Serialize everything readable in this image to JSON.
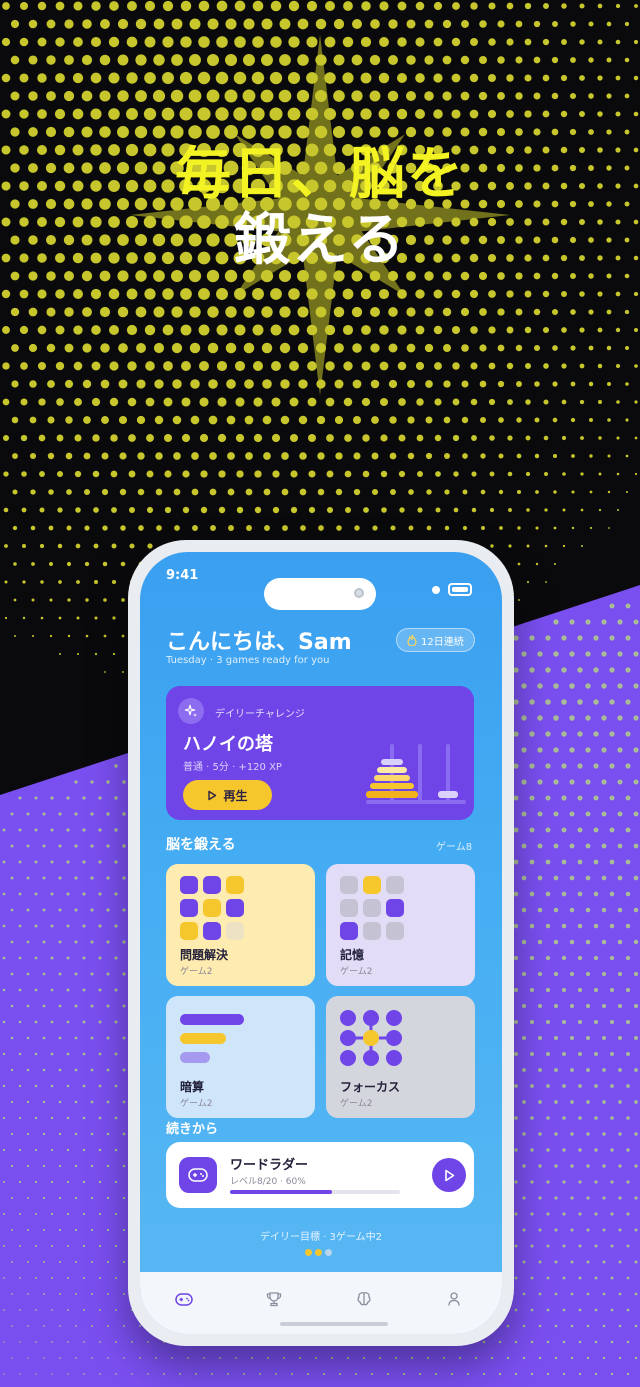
{
  "headline": {
    "line1": "毎日、脳を",
    "line2": "鍛える"
  },
  "colors": {
    "accent_yellow": "#f3f323",
    "purple": "#6f45e8",
    "sky_blue": "#46aef3",
    "gold": "#f6c62d"
  },
  "status_bar": {
    "time": "9:41"
  },
  "header": {
    "greeting": "こんにちは、Sam",
    "subtitle": "Tuesday · 3 games ready for you",
    "streak": "12日連続",
    "streak_icon": "flame-icon"
  },
  "daily_challenge": {
    "tag": "デイリーチャレンジ",
    "title": "ハノイの塔",
    "meta": "普通 · 5分 · +120 XP",
    "play_label": "再生",
    "icon": "sparkle-icon"
  },
  "training": {
    "title": "脳を鍛える",
    "count": "ゲーム8",
    "categories": [
      {
        "name": "問題解決",
        "count": "ゲーム2"
      },
      {
        "name": "記憶",
        "count": "ゲーム2"
      },
      {
        "name": "暗算",
        "count": "ゲーム2"
      },
      {
        "name": "フォーカス",
        "count": "ゲーム2"
      }
    ]
  },
  "continue": {
    "title": "続きから",
    "game": "ワードラダー",
    "meta": "レベル8/20 · 60%",
    "progress": 0.6,
    "icon": "gamepad-icon"
  },
  "daily_goal": "デイリー目標 · 3ゲーム中2",
  "daily_goal_done": 2,
  "daily_goal_total": 3,
  "tabbar": {
    "tabs": [
      "gamepad-icon",
      "trophy-icon",
      "brain-icon",
      "profile-icon"
    ]
  }
}
